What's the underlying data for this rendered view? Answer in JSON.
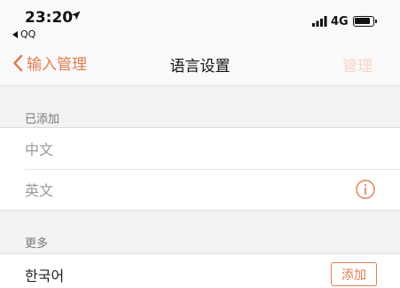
{
  "status_bar": {
    "time": "23:20",
    "back_app": "QQ",
    "network": "4G"
  },
  "nav": {
    "back_label": "输入管理",
    "title": "语言设置",
    "action_label": "管理"
  },
  "sections": {
    "added": {
      "header": "已添加",
      "items": [
        {
          "label": "中文"
        },
        {
          "label": "英文"
        }
      ]
    },
    "more": {
      "header": "更多",
      "items": [
        {
          "label": "한국어",
          "action": "添加"
        }
      ]
    }
  },
  "colors": {
    "accent": "#e07d52",
    "accent_disabled": "#f6d5c6",
    "background": "#f2f2f2"
  }
}
